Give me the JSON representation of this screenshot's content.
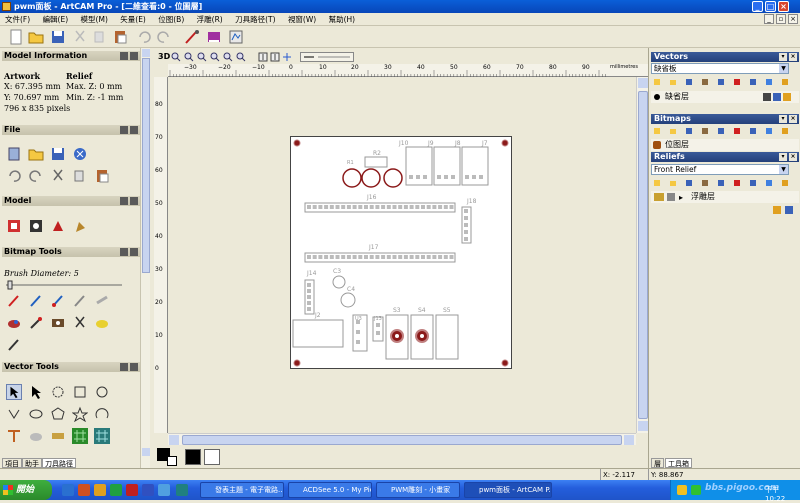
{
  "window": {
    "title": "pwm面板 - ArtCAM Pro - [二維查看:0 - 位圖層]"
  },
  "menu": [
    "文件(F)",
    "編輯(E)",
    "模型(M)",
    "矢量(E)",
    "位图(B)",
    "浮雕(R)",
    "刀具路径(T)",
    "視窗(W)",
    "幫助(H)"
  ],
  "view": {
    "label_3d": "3D"
  },
  "ruler": {
    "unit": "millimetres",
    "top_ticks": [
      "−30",
      "−20",
      "−10",
      "0",
      "10",
      "20",
      "30",
      "40",
      "50",
      "60",
      "70",
      "80",
      "90"
    ],
    "left_ticks": [
      "80",
      "70",
      "60",
      "50",
      "40",
      "30",
      "20",
      "10",
      "0"
    ]
  },
  "left": {
    "model_info": {
      "title": "Model Information",
      "artwork_label": "Artwork",
      "relief_label": "Relief",
      "x": "X: 67.395 mm",
      "y": "Y: 70.697 mm",
      "max_z": "Max. Z: 0 mm",
      "min_z": "Min. Z: -1 mm",
      "pixels": "796 x 835 pixels"
    },
    "file_title": "File",
    "model_title": "Model",
    "bitmap_tools": {
      "title": "Bitmap Tools",
      "brush_label": "Brush Diameter:",
      "brush_value": "5"
    },
    "vector_tools_title": "Vector Tools",
    "tabs": [
      "項目",
      "助手",
      "刀具路徑"
    ]
  },
  "right": {
    "vectors": {
      "title": "Vectors",
      "combo": "缺省板",
      "layer": "缺省层"
    },
    "bitmaps": {
      "title": "Bitmaps",
      "layer": "位图层"
    },
    "reliefs": {
      "title": "Reliefs",
      "combo": "Front Relief",
      "layer": "浮雕层"
    },
    "tabs": [
      "層",
      "工具箱"
    ]
  },
  "pcb_labels": {
    "r2": "R2",
    "r1": "R1",
    "j10": "J10",
    "j9": "J9",
    "j8": "J8",
    "j7": "J7",
    "j16": "J16",
    "j18": "J18",
    "j17": "J17",
    "j14": "J14",
    "c3": "C3",
    "c4": "C4",
    "j2": "J2",
    "u3": "U3",
    "j13": "J13",
    "s3": "S3",
    "s4": "S4",
    "s5": "S5"
  },
  "status": {
    "x": "X: -2.117",
    "y": "Y: 88.867"
  },
  "taskbar": {
    "start": "開始",
    "tasks": [
      "發表主題 - 電子電路...",
      "ACDSee 5.0 - My Pict...",
      "PWM雕刻 - 小畫家",
      "pwm面板 - ArtCAM P..."
    ],
    "clock": "下午 10:22",
    "watermark": "bbs.pigoo.com"
  },
  "colors": {
    "title_blue": "#0846b8",
    "panel_blue": "#24407a",
    "board_pad": "#8b1a1a",
    "taskbar": "#245edc"
  }
}
